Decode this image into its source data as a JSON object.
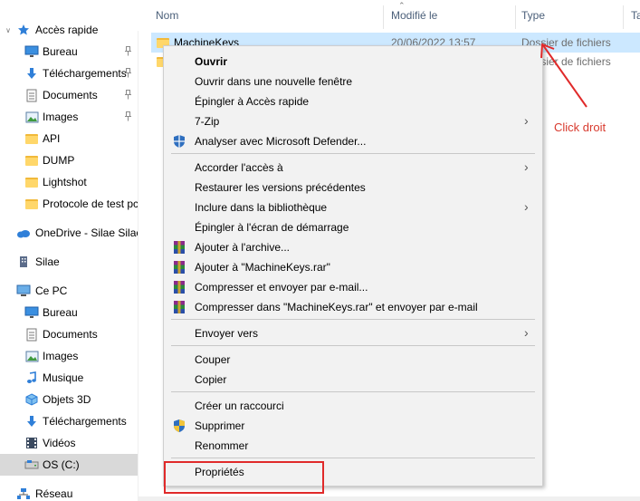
{
  "sidebar": {
    "items": [
      {
        "label": "Accès rapide",
        "icon": "star-icon",
        "level": 0,
        "chev": true,
        "pinned": false
      },
      {
        "label": "Bureau",
        "icon": "desktop-icon",
        "level": 1,
        "pinned": true
      },
      {
        "label": "Téléchargements",
        "icon": "download-icon",
        "level": 1,
        "pinned": true
      },
      {
        "label": "Documents",
        "icon": "document-icon",
        "level": 1,
        "pinned": true
      },
      {
        "label": "Images",
        "icon": "pictures-icon",
        "level": 1,
        "pinned": true
      },
      {
        "label": "API",
        "icon": "folder-icon",
        "level": 1,
        "pinned": false
      },
      {
        "label": "DUMP",
        "icon": "folder-icon",
        "level": 1,
        "pinned": false
      },
      {
        "label": "Lightshot",
        "icon": "folder-icon",
        "level": 1,
        "pinned": false
      },
      {
        "label": "Protocole de test pc",
        "icon": "folder-icon",
        "level": 1,
        "pinned": false
      },
      {
        "label": "OneDrive - Silae Silae",
        "icon": "cloud-icon",
        "level": 0,
        "pinned": false
      },
      {
        "label": "Silae",
        "icon": "building-icon",
        "level": 0,
        "pinned": false
      },
      {
        "label": "Ce PC",
        "icon": "computer-icon",
        "level": 0,
        "pinned": false
      },
      {
        "label": "Bureau",
        "icon": "desktop-icon",
        "level": 1,
        "pinned": false
      },
      {
        "label": "Documents",
        "icon": "document-icon",
        "level": 1,
        "pinned": false
      },
      {
        "label": "Images",
        "icon": "pictures-icon",
        "level": 1,
        "pinned": false
      },
      {
        "label": "Musique",
        "icon": "music-icon",
        "level": 1,
        "pinned": false
      },
      {
        "label": "Objets 3D",
        "icon": "cube-icon",
        "level": 1,
        "pinned": false
      },
      {
        "label": "Téléchargements",
        "icon": "download-icon",
        "level": 1,
        "pinned": false
      },
      {
        "label": "Vidéos",
        "icon": "video-icon",
        "level": 1,
        "pinned": false
      },
      {
        "label": "OS (C:)",
        "icon": "drive-icon",
        "level": 1,
        "pinned": false,
        "selected": true
      },
      {
        "label": "Réseau",
        "icon": "network-icon",
        "level": 0,
        "pinned": false
      }
    ]
  },
  "columns": {
    "name": "Nom",
    "modified": "Modifié le",
    "type": "Type",
    "size": "Ta"
  },
  "files": [
    {
      "name": "MachineKeys",
      "modified": "20/06/2022 13:57",
      "type": "Dossier de fichiers",
      "selected": true
    },
    {
      "name": "",
      "modified": "",
      "type": "Dossier de fichiers",
      "selected": false
    }
  ],
  "menu": {
    "items": [
      {
        "label": "Ouvrir",
        "bold": true,
        "icon": "",
        "submenu": false
      },
      {
        "label": "Ouvrir dans une nouvelle fenêtre",
        "bold": false,
        "icon": "",
        "submenu": false
      },
      {
        "label": "Épingler à Accès rapide",
        "bold": false,
        "icon": "",
        "submenu": false
      },
      {
        "label": "7-Zip",
        "bold": false,
        "icon": "",
        "submenu": true
      },
      {
        "label": "Analyser avec Microsoft Defender...",
        "bold": false,
        "icon": "defender-shield-icon",
        "submenu": false
      },
      {
        "sep": true
      },
      {
        "label": "Accorder l'accès à",
        "bold": false,
        "icon": "",
        "submenu": true
      },
      {
        "label": "Restaurer les versions précédentes",
        "bold": false,
        "icon": "",
        "submenu": false
      },
      {
        "label": "Inclure dans la bibliothèque",
        "bold": false,
        "icon": "",
        "submenu": true
      },
      {
        "label": "Épingler à l'écran de démarrage",
        "bold": false,
        "icon": "",
        "submenu": false
      },
      {
        "label": "Ajouter à l'archive...",
        "bold": false,
        "icon": "winrar-icon",
        "submenu": false
      },
      {
        "label": "Ajouter à \"MachineKeys.rar\"",
        "bold": false,
        "icon": "winrar-icon",
        "submenu": false
      },
      {
        "label": "Compresser et envoyer par e-mail...",
        "bold": false,
        "icon": "winrar-icon",
        "submenu": false
      },
      {
        "label": "Compresser dans \"MachineKeys.rar\" et envoyer par e-mail",
        "bold": false,
        "icon": "winrar-icon",
        "submenu": false
      },
      {
        "sep": true
      },
      {
        "label": "Envoyer vers",
        "bold": false,
        "icon": "",
        "submenu": true
      },
      {
        "sep": true
      },
      {
        "label": "Couper",
        "bold": false,
        "icon": "",
        "submenu": false
      },
      {
        "label": "Copier",
        "bold": false,
        "icon": "",
        "submenu": false
      },
      {
        "sep": true
      },
      {
        "label": "Créer un raccourci",
        "bold": false,
        "icon": "",
        "submenu": false
      },
      {
        "label": "Supprimer",
        "bold": false,
        "icon": "uac-shield-icon",
        "submenu": false
      },
      {
        "label": "Renommer",
        "bold": false,
        "icon": "",
        "submenu": false
      },
      {
        "sep": true
      },
      {
        "label": "Propriétés",
        "bold": false,
        "icon": "",
        "submenu": false
      }
    ]
  },
  "annotation": {
    "text": "Click droit",
    "color": "#d83a2e"
  },
  "colors": {
    "selection": "#cce8ff",
    "menu_bg": "#f2f2f2",
    "highlight_box": "#e02a2a",
    "folder": "#ffd76a"
  }
}
